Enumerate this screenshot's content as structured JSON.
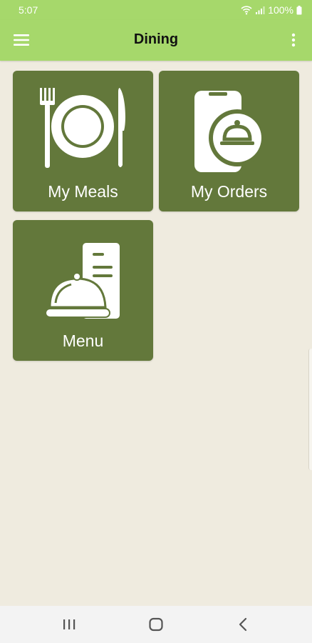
{
  "status_bar": {
    "time": "5:07",
    "battery": "100%",
    "icons": [
      "wifi-icon",
      "signal-icon",
      "battery-icon"
    ]
  },
  "app_bar": {
    "title": "Dining",
    "menu_icon": "hamburger-menu-icon",
    "more_icon": "more-vert-icon"
  },
  "tiles": [
    {
      "label": "My Meals",
      "icon": "plate-fork-knife-icon"
    },
    {
      "label": "My Orders",
      "icon": "phone-cloche-icon"
    },
    {
      "label": "Menu",
      "icon": "cloche-menu-icon"
    }
  ],
  "nav_bar": {
    "icons": [
      "recent-apps-icon",
      "home-icon",
      "back-icon"
    ]
  },
  "colors": {
    "app_bar": "#a6d86b",
    "background": "#efebdf",
    "tile": "#63783b",
    "tile_text": "#ffffff"
  }
}
